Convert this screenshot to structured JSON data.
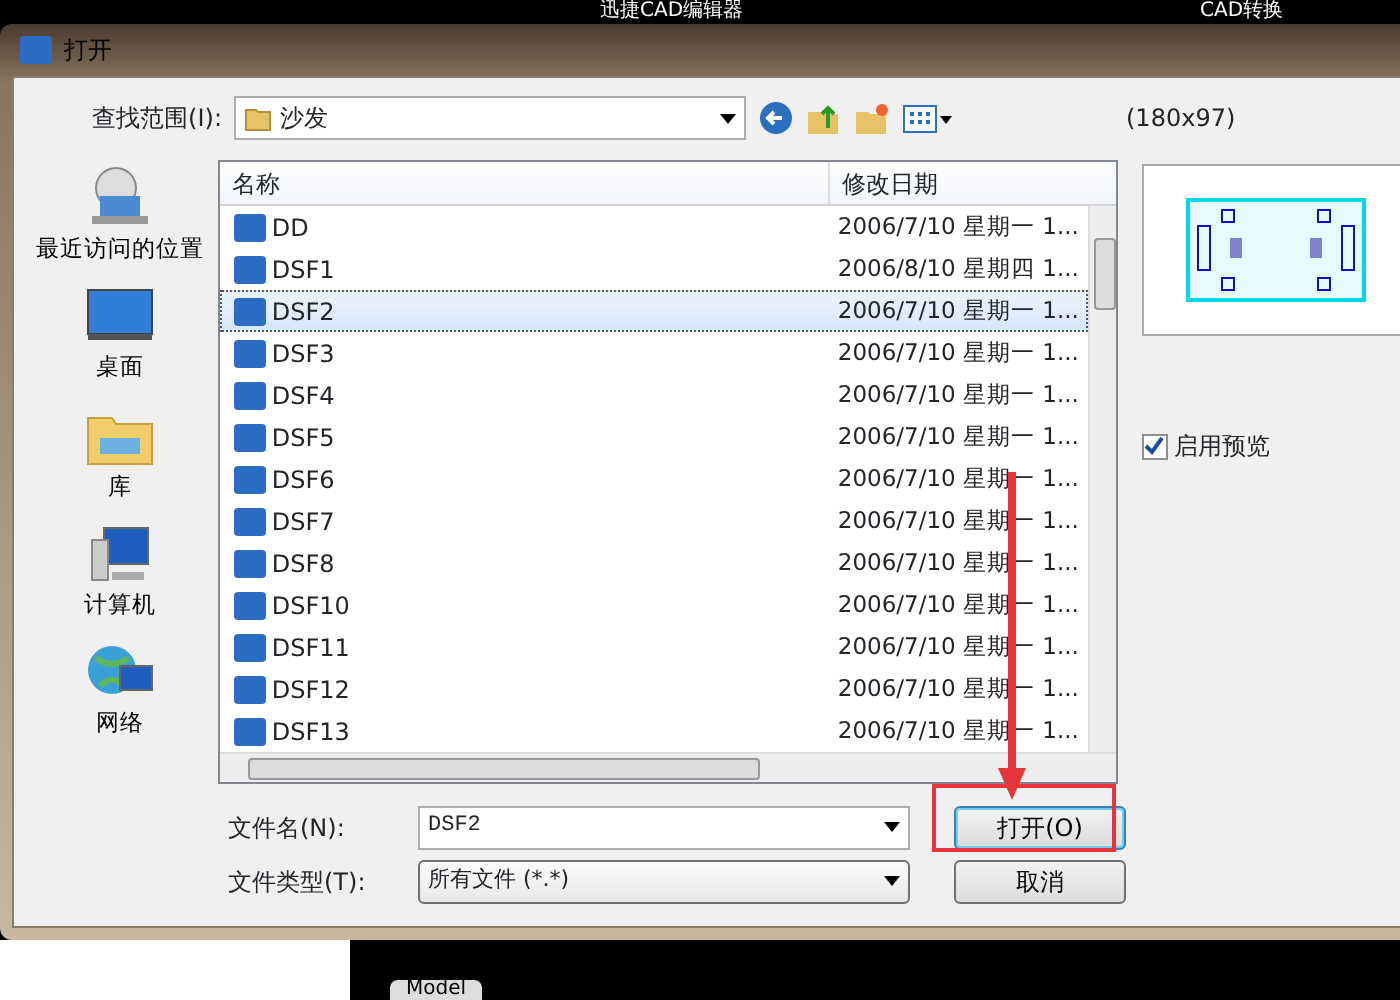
{
  "app_bar": {
    "title": "迅捷CAD编辑器",
    "right_label": "CAD转换"
  },
  "dialog": {
    "title": "打开",
    "look_in_label": "查找范围(I):",
    "look_in_value": "沙发",
    "places": [
      {
        "kind": "recent",
        "label": "最近访问的位置"
      },
      {
        "kind": "desktop",
        "label": "桌面"
      },
      {
        "kind": "library",
        "label": "库"
      },
      {
        "kind": "computer",
        "label": "计算机"
      },
      {
        "kind": "network",
        "label": "网络"
      }
    ],
    "file_list": {
      "columns": [
        "名称",
        "修改日期"
      ],
      "rows": [
        {
          "name": "DD",
          "date": "2006/7/10 星期一 1...",
          "selected": false
        },
        {
          "name": "DSF1",
          "date": "2006/8/10 星期四 1...",
          "selected": false
        },
        {
          "name": "DSF2",
          "date": "2006/7/10 星期一 1...",
          "selected": true
        },
        {
          "name": "DSF3",
          "date": "2006/7/10 星期一 1...",
          "selected": false
        },
        {
          "name": "DSF4",
          "date": "2006/7/10 星期一 1...",
          "selected": false
        },
        {
          "name": "DSF5",
          "date": "2006/7/10 星期一 1...",
          "selected": false
        },
        {
          "name": "DSF6",
          "date": "2006/7/10 星期一 1...",
          "selected": false
        },
        {
          "name": "DSF7",
          "date": "2006/7/10 星期一 1...",
          "selected": false
        },
        {
          "name": "DSF8",
          "date": "2006/7/10 星期一 1...",
          "selected": false
        },
        {
          "name": "DSF10",
          "date": "2006/7/10 星期一 1...",
          "selected": false
        },
        {
          "name": "DSF11",
          "date": "2006/7/10 星期一 1...",
          "selected": false
        },
        {
          "name": "DSF12",
          "date": "2006/7/10 星期一 1...",
          "selected": false
        },
        {
          "name": "DSF13",
          "date": "2006/7/10 星期一 1...",
          "selected": false
        }
      ]
    },
    "preview_size": "(180x97)",
    "preview_enabled": {
      "label": "启用预览",
      "checked": true
    },
    "file_name": {
      "label": "文件名(N):",
      "value": "DSF2"
    },
    "file_type": {
      "label": "文件类型(T):",
      "value": "所有文件 (*.*)"
    },
    "buttons": [
      "打开(O)",
      "取消"
    ]
  },
  "bottom_tab": "Model"
}
